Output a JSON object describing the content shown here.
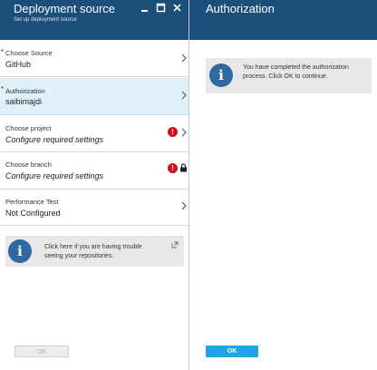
{
  "left_blade": {
    "title": "Deployment source",
    "subtitle": "Set up deployment source",
    "rows": [
      {
        "label": "Choose Source",
        "value": "GitHub",
        "required": "*"
      },
      {
        "label": "Authorization",
        "value": "saibimajdi",
        "required": "*"
      },
      {
        "label": "Choose project",
        "value": "Configure required settings",
        "error": "!"
      },
      {
        "label": "Choose branch",
        "value": "Configure required settings",
        "error": "!"
      },
      {
        "label": "Performance Test",
        "value": "Not Configured"
      }
    ],
    "info_text": "Click here if you are having trouble seeing your repositories.",
    "ok_label": "OK"
  },
  "right_blade": {
    "title": "Authorization",
    "info_text": "You have completed the authorization process.  Click OK to continue.",
    "ok_label": "OK"
  },
  "icons": {
    "info": "i",
    "minimize": "minimize-icon",
    "maximize": "maximize-icon",
    "close": "close-icon"
  },
  "colors": {
    "header_bg": "#1b4f7a",
    "selected_row": "#dff2fb",
    "error": "#d10e1a",
    "ok_primary": "#1ea5e8",
    "info_icon": "#2e6aa0"
  }
}
